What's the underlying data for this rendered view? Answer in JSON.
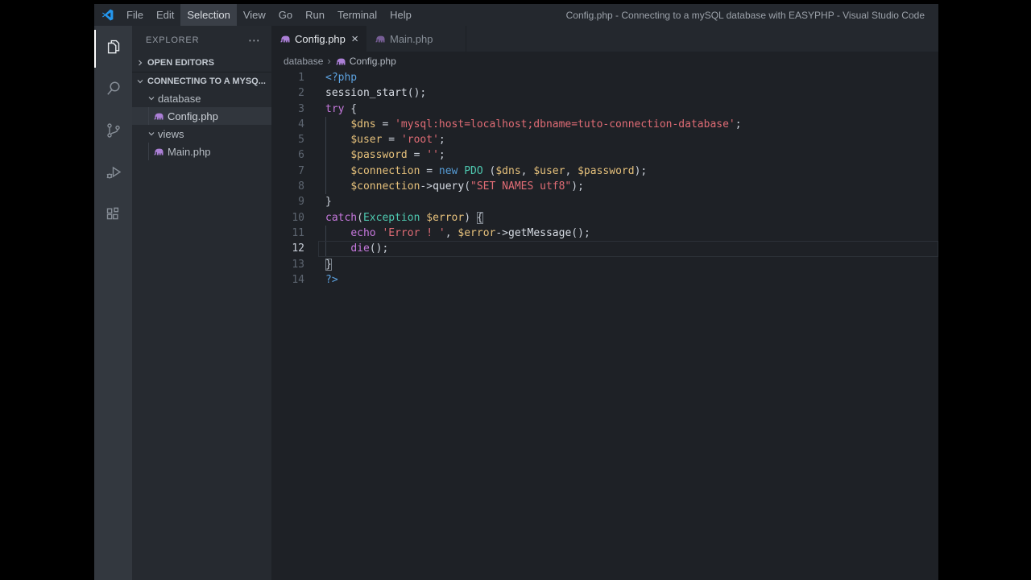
{
  "window": {
    "title": "Config.php - Connecting to a mySQL database with EASYPHP - Visual Studio Code"
  },
  "menubar": {
    "items": [
      {
        "label": "File"
      },
      {
        "label": "Edit"
      },
      {
        "label": "Selection",
        "active": true
      },
      {
        "label": "View"
      },
      {
        "label": "Go"
      },
      {
        "label": "Run"
      },
      {
        "label": "Terminal"
      },
      {
        "label": "Help"
      }
    ]
  },
  "activity_bar": {
    "items": [
      {
        "icon": "files-icon",
        "active": true
      },
      {
        "icon": "search-icon"
      },
      {
        "icon": "source-control-icon"
      },
      {
        "icon": "run-debug-icon"
      },
      {
        "icon": "extensions-icon"
      }
    ]
  },
  "sidebar": {
    "title": "EXPLORER",
    "more_label": "⋯",
    "sections": [
      {
        "label": "OPEN EDITORS",
        "collapsed": true
      },
      {
        "label": "CONNECTING TO A MYSQ...",
        "collapsed": false,
        "bordered": true
      }
    ],
    "tree": [
      {
        "label": "database",
        "type": "folder",
        "indent": 0
      },
      {
        "label": "Config.php",
        "type": "php",
        "indent": 1,
        "selected": true
      },
      {
        "label": "views",
        "type": "folder",
        "indent": 0
      },
      {
        "label": "Main.php",
        "type": "php",
        "indent": 1
      }
    ]
  },
  "tabs": [
    {
      "label": "Config.php",
      "active": true,
      "close": "×"
    },
    {
      "label": "Main.php"
    }
  ],
  "breadcrumb": {
    "items": [
      "database",
      "Config.php"
    ],
    "separator": "›"
  },
  "theme": {
    "tag": "#5ca2e0",
    "keyword": "#c678dd",
    "keyword2": "#569cd6",
    "variable": "#e5c07b",
    "string": "#e06c75",
    "class": "#4ec9b0",
    "function": "#d7dce4",
    "punctuation": "#c9cfd8",
    "elephant": "#ab7fd6"
  },
  "editor": {
    "lines": [
      {
        "num": "1",
        "tokens": [
          [
            "tag",
            "<?php"
          ]
        ]
      },
      {
        "num": "2",
        "tokens": [
          [
            "fn",
            "session_start"
          ],
          [
            "pun",
            "();"
          ]
        ]
      },
      {
        "num": "3",
        "tokens": [
          [
            "kw",
            "try"
          ],
          [
            "pun",
            " {"
          ]
        ]
      },
      {
        "num": "4",
        "guide": true,
        "tokens": [
          [
            "pun",
            "    "
          ],
          [
            "var",
            "$dns"
          ],
          [
            "pun",
            " = "
          ],
          [
            "str",
            "'mysql:host=localhost;dbname=tuto-connection-database'"
          ],
          [
            "pun",
            ";"
          ]
        ]
      },
      {
        "num": "5",
        "guide": true,
        "tokens": [
          [
            "pun",
            "    "
          ],
          [
            "var",
            "$user"
          ],
          [
            "pun",
            " = "
          ],
          [
            "str",
            "'root'"
          ],
          [
            "pun",
            ";"
          ]
        ]
      },
      {
        "num": "6",
        "guide": true,
        "tokens": [
          [
            "pun",
            "    "
          ],
          [
            "var",
            "$password"
          ],
          [
            "pun",
            " = "
          ],
          [
            "str",
            "''"
          ],
          [
            "pun",
            ";"
          ]
        ]
      },
      {
        "num": "7",
        "guide": true,
        "tokens": [
          [
            "pun",
            "    "
          ],
          [
            "var",
            "$connection"
          ],
          [
            "pun",
            " = "
          ],
          [
            "kw2",
            "new"
          ],
          [
            "pun",
            " "
          ],
          [
            "cls",
            "PDO"
          ],
          [
            "pun",
            " ("
          ],
          [
            "var",
            "$dns"
          ],
          [
            "pun",
            ", "
          ],
          [
            "var",
            "$user"
          ],
          [
            "pun",
            ", "
          ],
          [
            "var",
            "$password"
          ],
          [
            "pun",
            ");"
          ]
        ]
      },
      {
        "num": "8",
        "guide": true,
        "tokens": [
          [
            "pun",
            "    "
          ],
          [
            "var",
            "$connection"
          ],
          [
            "pun",
            "->"
          ],
          [
            "fn",
            "query"
          ],
          [
            "pun",
            "("
          ],
          [
            "str",
            "\"SET NAMES utf8\""
          ],
          [
            "pun",
            ");"
          ]
        ]
      },
      {
        "num": "9",
        "tokens": [
          [
            "pun",
            "}"
          ]
        ]
      },
      {
        "num": "10",
        "tokens": [
          [
            "kw",
            "catch"
          ],
          [
            "pun",
            "("
          ],
          [
            "cls",
            "Exception"
          ],
          [
            "pun",
            " "
          ],
          [
            "var",
            "$error"
          ],
          [
            "pun",
            ") "
          ],
          [
            "box",
            "{"
          ]
        ]
      },
      {
        "num": "11",
        "guide": true,
        "tokens": [
          [
            "pun",
            "    "
          ],
          [
            "kw",
            "echo"
          ],
          [
            "pun",
            " "
          ],
          [
            "str",
            "'Error ! '"
          ],
          [
            "pun",
            ", "
          ],
          [
            "var",
            "$error"
          ],
          [
            "pun",
            "->"
          ],
          [
            "fn",
            "getMessage"
          ],
          [
            "pun",
            "();"
          ]
        ]
      },
      {
        "num": "12",
        "guide": true,
        "current": true,
        "tokens": [
          [
            "pun",
            "    "
          ],
          [
            "kw",
            "die"
          ],
          [
            "pun",
            "();"
          ]
        ]
      },
      {
        "num": "13",
        "tokens": [
          [
            "box",
            "}"
          ]
        ]
      },
      {
        "num": "14",
        "tokens": [
          [
            "tag",
            "?>"
          ]
        ]
      }
    ]
  }
}
